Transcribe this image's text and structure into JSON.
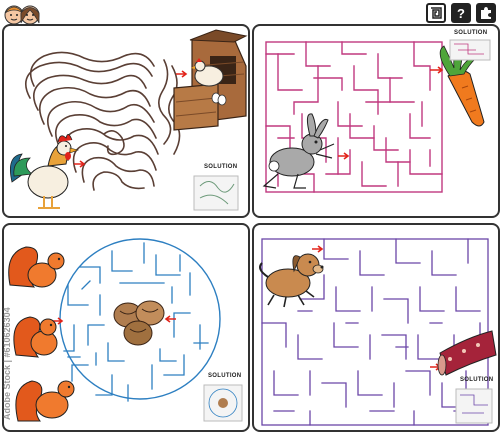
{
  "toolbar": {
    "icons": [
      "maze-icon",
      "help-icon",
      "puzzle-icon"
    ],
    "help_label": "?"
  },
  "panels": [
    {
      "animal": "rooster",
      "goal": "hen-in-coop",
      "maze_color": "#5a3f35",
      "solution_label": "SOLUTION"
    },
    {
      "animal": "rabbit",
      "goal": "carrot",
      "maze_color": "#c0397f",
      "solution_label": "SOLUTION"
    },
    {
      "animal": "squirrels",
      "goal": "walnuts",
      "maze_color": "#2d7fc1",
      "solution_label": "SOLUTION"
    },
    {
      "animal": "dog",
      "goal": "sausage",
      "maze_color": "#6b46a8",
      "solution_label": "SOLUTION"
    }
  ],
  "colors": {
    "arrow": "#e2231a",
    "border": "#333333"
  },
  "watermark": "Adobe Stock | #610626304"
}
